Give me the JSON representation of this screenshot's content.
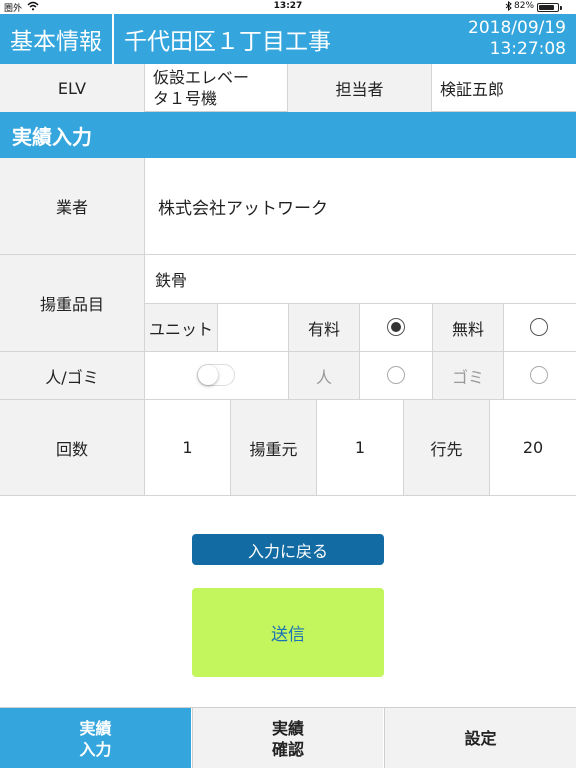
{
  "status_bar": {
    "carrier": "圏外",
    "wifi_icon": "wifi-icon",
    "time": "13:27",
    "bluetooth_icon": "bluetooth-icon",
    "battery": "82%",
    "battery_level": 0.82
  },
  "header": {
    "basic_info": "基本情報",
    "site_name": "千代田区１丁目工事",
    "date": "2018/09/19",
    "time": "13:27:08"
  },
  "elv_row": {
    "elv_label": "ELV",
    "elevator_name": "仮設エレベー\nタ１号機",
    "person_label": "担当者",
    "person_name": "検証五郎"
  },
  "section_title": "実績入力",
  "form": {
    "vendor_label": "業者",
    "vendor_value": "株式会社アットワーク",
    "item_label": "揚重品目",
    "item_value": "鉄骨",
    "unit_label": "ユニット",
    "paid_label": "有料",
    "paid_selected": true,
    "free_label": "無料",
    "free_selected": false,
    "person_trash_label": "人/ゴミ",
    "toggle_on": false,
    "person_label": "人",
    "trash_label": "ゴミ",
    "count_label": "回数",
    "count_value": "1",
    "origin_label": "揚重元",
    "origin_value": "1",
    "destination_label": "行先",
    "destination_value": "20"
  },
  "buttons": {
    "back": "入力に戻る",
    "send": "送信"
  },
  "tabs": [
    {
      "label": "実績\n入力",
      "active": true
    },
    {
      "label": "実績\n確認",
      "active": false
    },
    {
      "label": "設定",
      "active": false
    }
  ],
  "colors": {
    "header_blue": "#35a6dd",
    "button_blue": "#136ba3",
    "send_green": "#c3f55d",
    "label_gray": "#f2f2f2"
  }
}
